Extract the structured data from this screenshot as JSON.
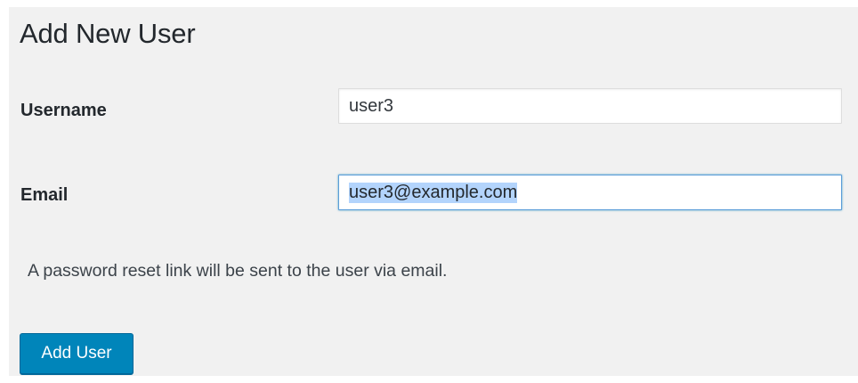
{
  "page": {
    "title": "Add New User"
  },
  "form": {
    "username": {
      "label": "Username",
      "value": "user3"
    },
    "email": {
      "label": "Email",
      "value": "user3@example.com",
      "text_selected": true
    },
    "note": "A password reset link will be sent to the user via email.",
    "submit_label": "Add User"
  },
  "colors": {
    "panel_background": "#f1f1f1",
    "primary_button": "#0085ba",
    "focus_border": "#5b9dd9",
    "selection_highlight": "#b3d4fc"
  }
}
